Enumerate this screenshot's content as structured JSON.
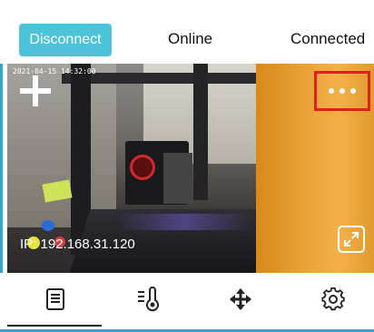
{
  "status_bar": {
    "disconnect_label": "Disconnect",
    "online_label": "Online",
    "connected_label": "Connected"
  },
  "camera": {
    "timestamp": "2021-04-15 14:32:00",
    "ip_label": "IP: 192.168.31.120",
    "add_icon": "plus-icon",
    "more_icon": "more-horizontal-icon",
    "fullscreen_icon": "expand-icon"
  },
  "bottom_nav": {
    "items": [
      {
        "icon": "document-icon",
        "active": true
      },
      {
        "icon": "temperature-icon",
        "active": false
      },
      {
        "icon": "move-arrows-icon",
        "active": false
      },
      {
        "icon": "settings-gear-icon",
        "active": false
      }
    ]
  },
  "colors": {
    "accent": "#4cc3d9",
    "highlight_border": "#e0201c",
    "frame": "#2fa8c9"
  }
}
